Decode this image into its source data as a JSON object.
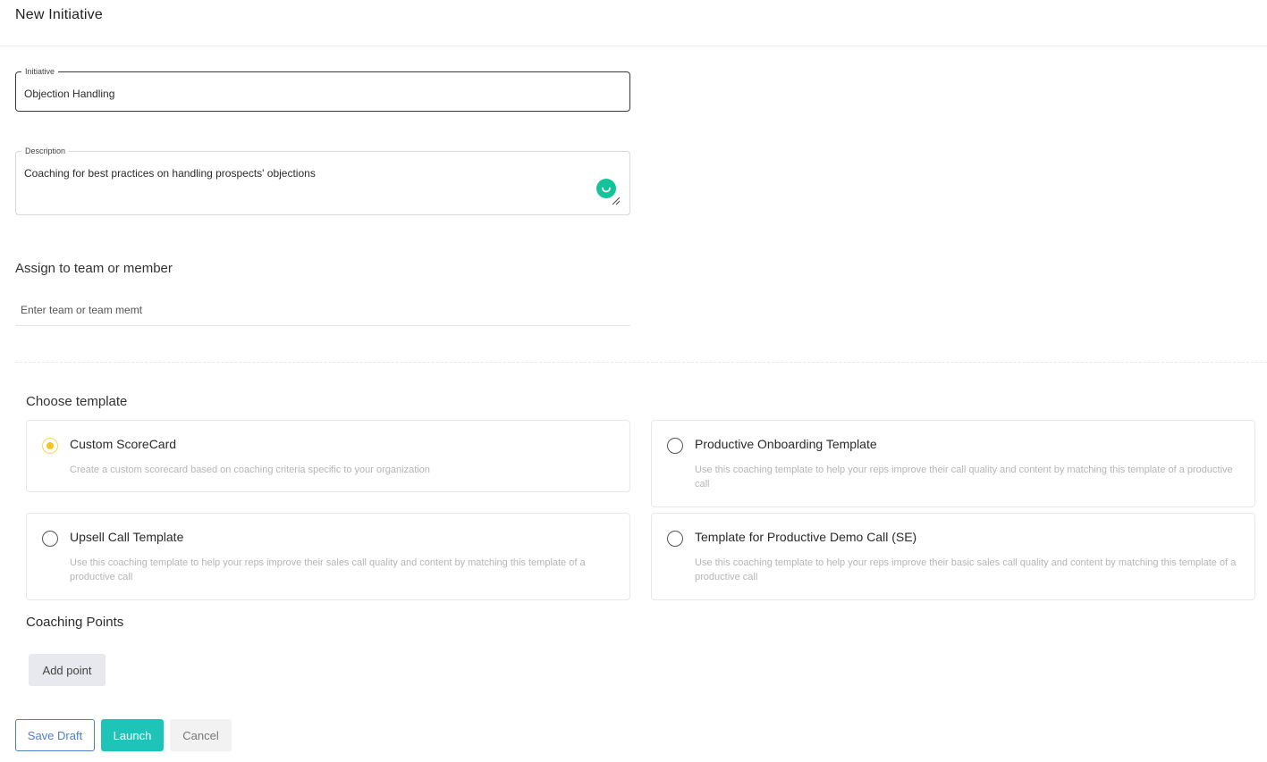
{
  "header": {
    "title": "New Initiative"
  },
  "form": {
    "initiative": {
      "label": "Initiative",
      "value": "Objection Handling"
    },
    "description": {
      "label": "Description",
      "value": "Coaching for best practices on handling prospects' objections"
    },
    "assign": {
      "label": "Assign to team or member",
      "placeholder": "Enter team or team memt"
    },
    "template_label": "Choose template",
    "templates": [
      {
        "title": "Custom ScoreCard",
        "description": "Create a custom scorecard based on coaching criteria specific to your organization",
        "selected": true
      },
      {
        "title": "Productive Onboarding Template",
        "description": "Use this coaching template to help your reps improve their call quality and content by matching this template of a productive call",
        "selected": false
      },
      {
        "title": "Upsell Call Template",
        "description": "Use this coaching template to help your reps improve their sales call quality and content by matching this template of a productive call",
        "selected": false
      },
      {
        "title": "Template for Productive Demo Call (SE)",
        "description": "Use this coaching template to help your reps improve their basic sales call quality and content by matching this template of a productive call",
        "selected": false
      }
    ],
    "coaching_points_label": "Coaching Points",
    "add_point_label": "Add point"
  },
  "actions": {
    "save_draft": "Save Draft",
    "launch": "Launch",
    "cancel": "Cancel"
  },
  "colors": {
    "accent_teal": "#1fc4b9",
    "save_outline": "#4f7ec6",
    "radio_selected": "#f3c623",
    "grammar_badge": "#15c39a"
  }
}
